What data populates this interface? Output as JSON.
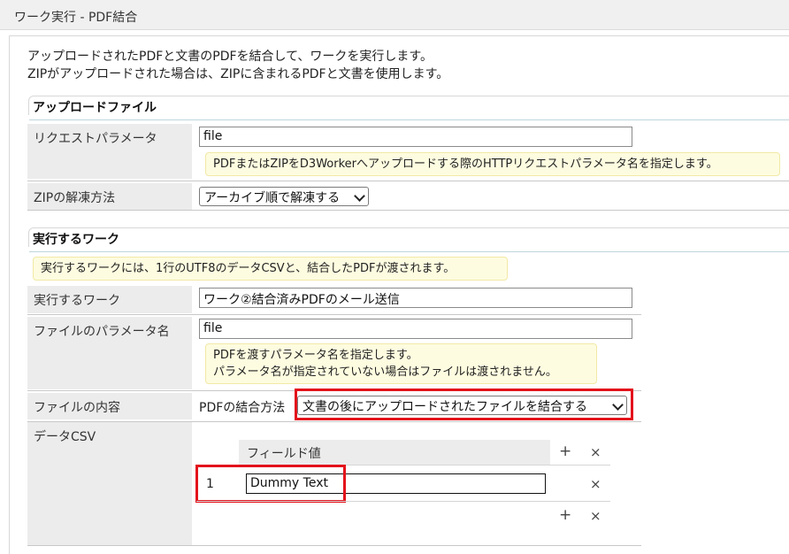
{
  "window": {
    "title": "ワーク実行 - PDF結合"
  },
  "intro": {
    "line1": "アップロードされたPDFと文書のPDFを結合して、ワークを実行します。",
    "line2": "ZIPがアップロードされた場合は、ZIPに含まれるPDFと文書を使用します。"
  },
  "upload_section": {
    "heading": "アップロードファイル",
    "request_param": {
      "label": "リクエストパラメータ",
      "value": "file",
      "hint": "PDFまたはZIPをD3Workerへアップロードする際のHTTPリクエストパラメータ名を指定します。"
    },
    "zip_method": {
      "label": "ZIPの解凍方法",
      "selected": "アーカイブ順で解凍する"
    }
  },
  "work_section": {
    "heading": "実行するワーク",
    "hint": "実行するワークには、1行のUTF8のデータCSVと、結合したPDFが渡されます。",
    "work": {
      "label": "実行するワーク",
      "value": "ワーク②結合済みPDFのメール送信"
    },
    "file_param": {
      "label": "ファイルのパラメータ名",
      "value": "file",
      "hint_line1": "PDFを渡すパラメータ名を指定します。",
      "hint_line2": "パラメータ名が指定されていない場合はファイルは渡されません。"
    },
    "file_content": {
      "label": "ファイルの内容",
      "combine_label": "PDFの結合方法",
      "combine_selected": "文書の後にアップロードされたファイルを結合する"
    },
    "data_csv": {
      "label": "データCSV",
      "column_header": "フィールド値",
      "rows": [
        {
          "index": "1",
          "value": "Dummy Text"
        }
      ]
    }
  },
  "icons": {
    "add": "+",
    "remove": "×"
  },
  "colors": {
    "highlight": "#e3121b",
    "hint_bg": "#fefce0",
    "label_bg": "#ececec"
  }
}
